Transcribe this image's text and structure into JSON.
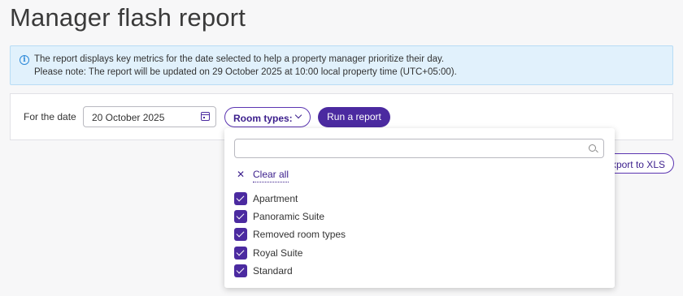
{
  "page": {
    "title": "Manager flash report"
  },
  "info": {
    "icon": "info-icon",
    "line1": "The report displays key metrics for the date selected to help a property manager prioritize their day.",
    "line2": "Please note: The report will be updated on 29 October 2025 at 10:00 local property time (UTC+05:00)."
  },
  "filters": {
    "date_label": "For the date",
    "date_value": "20 October 2025",
    "room_types_label": "Room types:",
    "run_label": "Run a report"
  },
  "export": {
    "label": "Export to XLS"
  },
  "dropdown": {
    "search_placeholder": "",
    "clear_all_label": "Clear all",
    "options": [
      {
        "label": "Apartment",
        "checked": true
      },
      {
        "label": "Panoramic Suite",
        "checked": true
      },
      {
        "label": "Removed room types",
        "checked": true
      },
      {
        "label": "Royal Suite",
        "checked": true
      },
      {
        "label": "Standard",
        "checked": true
      }
    ]
  },
  "colors": {
    "accent": "#4b2aa0",
    "info_bg": "#e1f1fc",
    "info_border": "#b8dcf5"
  }
}
